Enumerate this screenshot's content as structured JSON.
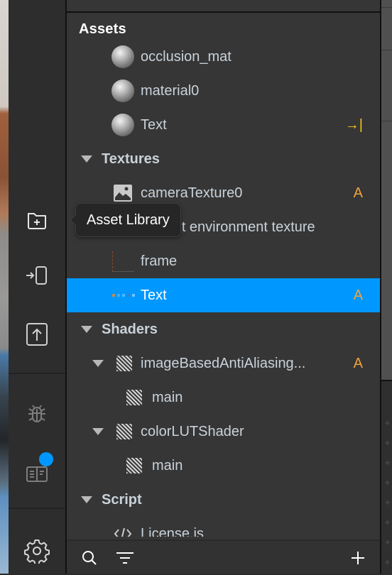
{
  "toolbar": {
    "items": [
      {
        "name": "asset-library",
        "icon": "folder-plus-icon"
      },
      {
        "name": "import-to-device",
        "icon": "device-import-icon"
      },
      {
        "name": "export",
        "icon": "upload-box-icon"
      },
      {
        "name": "debug",
        "icon": "bug-icon"
      },
      {
        "name": "docs",
        "icon": "book-icon",
        "has_badge": true
      },
      {
        "name": "settings",
        "icon": "gear-icon"
      }
    ],
    "badge_color": "#0098ff"
  },
  "tooltip": {
    "text": "Asset Library"
  },
  "assets_panel": {
    "title": "Assets",
    "rows": [
      {
        "type": "material",
        "label": "occlusion_mat"
      },
      {
        "type": "material",
        "label": "material0"
      },
      {
        "type": "material",
        "label": "Text",
        "trail": "→|"
      },
      {
        "type": "section",
        "label": "Textures"
      },
      {
        "type": "texture",
        "label": "cameraTexture0",
        "trail": "A"
      },
      {
        "type": "texture",
        "label": "Default environment texture"
      },
      {
        "type": "texture",
        "label": "frame"
      },
      {
        "type": "texture",
        "label": "Text",
        "trail": "A",
        "selected": true
      },
      {
        "type": "section",
        "label": "Shaders"
      },
      {
        "type": "shader",
        "label": "imageBasedAntiAliasing...",
        "trail": "A",
        "expanded": true
      },
      {
        "type": "shader-fn",
        "label": "main"
      },
      {
        "type": "shader",
        "label": "colorLUTShader",
        "expanded": true
      },
      {
        "type": "shader-fn",
        "label": "main"
      },
      {
        "type": "section",
        "label": "Script"
      },
      {
        "type": "script",
        "label": "License.js"
      }
    ]
  },
  "bottom_bar": {
    "search_icon": "search-icon",
    "filter_icon": "filter-icon",
    "add_icon": "plus-icon"
  },
  "colors": {
    "selection": "#0098ff",
    "badge_a": "#f2a33a",
    "link_arrow": "#f5c518"
  }
}
